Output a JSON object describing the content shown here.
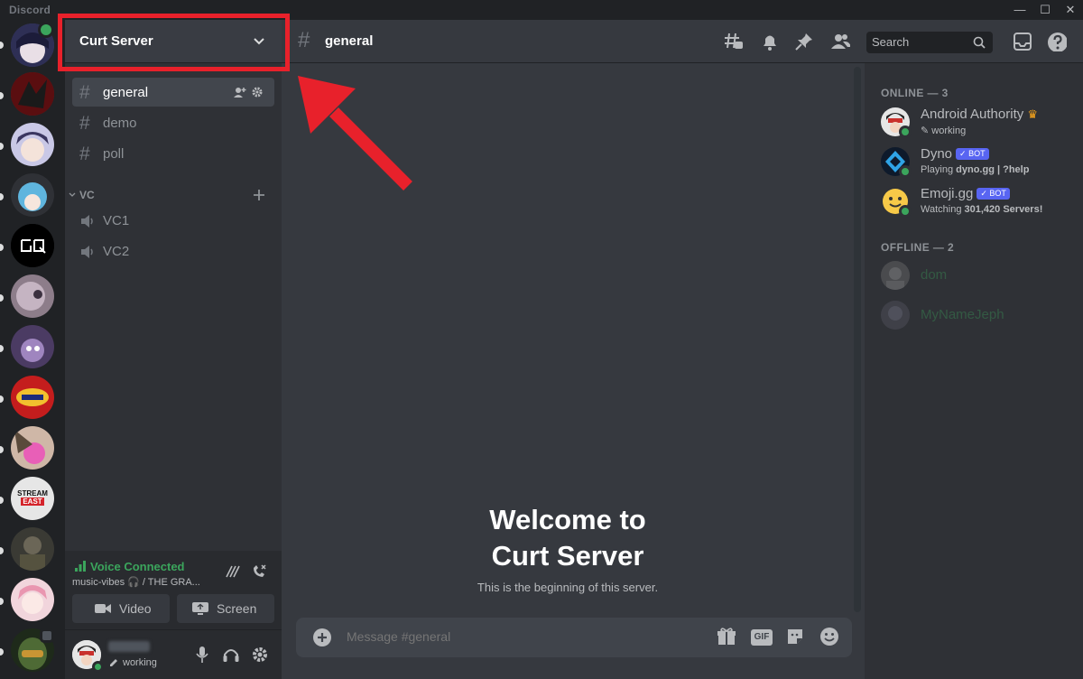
{
  "window": {
    "title": "Discord",
    "minimize": "—",
    "maximize": "☐",
    "close": "✕"
  },
  "server": {
    "name": "Curt Server"
  },
  "channels": [
    {
      "name": "general",
      "type": "text",
      "active": true
    },
    {
      "name": "demo",
      "type": "text",
      "active": false
    },
    {
      "name": "poll",
      "type": "text",
      "active": false
    }
  ],
  "category": {
    "name": "VC"
  },
  "voice_channels": [
    {
      "name": "VC1"
    },
    {
      "name": "VC2"
    }
  ],
  "voice_panel": {
    "status": "Voice Connected",
    "subtitle": "music-vibes 🎧 / THE GRA...",
    "video_label": "Video",
    "screen_label": "Screen"
  },
  "user_panel": {
    "status": "working"
  },
  "chat_header": {
    "hash": "#",
    "channel": "general",
    "search_placeholder": "Search"
  },
  "welcome": {
    "line1": "Welcome to",
    "line2": "Curt Server",
    "subtitle": "This is the beginning of this server."
  },
  "composer": {
    "placeholder": "Message #general",
    "gif_label": "GIF"
  },
  "members": {
    "online_header": "ONLINE — 3",
    "offline_header": "OFFLINE — 2",
    "online": [
      {
        "name": "Android Authority",
        "activity": "working",
        "bot": false,
        "crown": true
      },
      {
        "name": "Dyno",
        "activity_prefix": "Playing ",
        "activity_bold": "dyno.gg | ?help",
        "bot": true,
        "bot_label": "✓ BOT"
      },
      {
        "name": "Emoji.gg",
        "activity_prefix": "Watching ",
        "activity_bold": "301,420 Servers!",
        "bot": true,
        "bot_label": "✓ BOT"
      }
    ],
    "offline": [
      {
        "name": "dom"
      },
      {
        "name": "MyNameJeph"
      }
    ]
  },
  "colors": {
    "annotation": "#e8212b",
    "online": "#3ba55c",
    "bot_tag": "#5865f2"
  },
  "guild_badges": {
    "stream_east_line1": "STREAM",
    "stream_east_line2": "EAST"
  }
}
